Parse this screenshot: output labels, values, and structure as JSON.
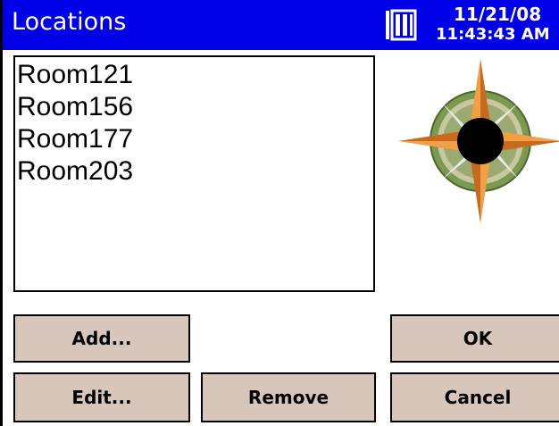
{
  "title_bar": {
    "title": "Locations",
    "date": "11/21/08",
    "time": "11:43:43 AM",
    "background": "#0000e8"
  },
  "locations": {
    "items": [
      {
        "label": "Room121"
      },
      {
        "label": "Room156"
      },
      {
        "label": "Room177"
      },
      {
        "label": "Room203"
      }
    ]
  },
  "buttons": {
    "add": "Add...",
    "edit": "Edit...",
    "remove": "Remove",
    "ok": "OK",
    "cancel": "Cancel",
    "color": "#d9c6ba"
  },
  "icons": {
    "battery": "battery-icon",
    "compass": "compass-rose-icon"
  }
}
